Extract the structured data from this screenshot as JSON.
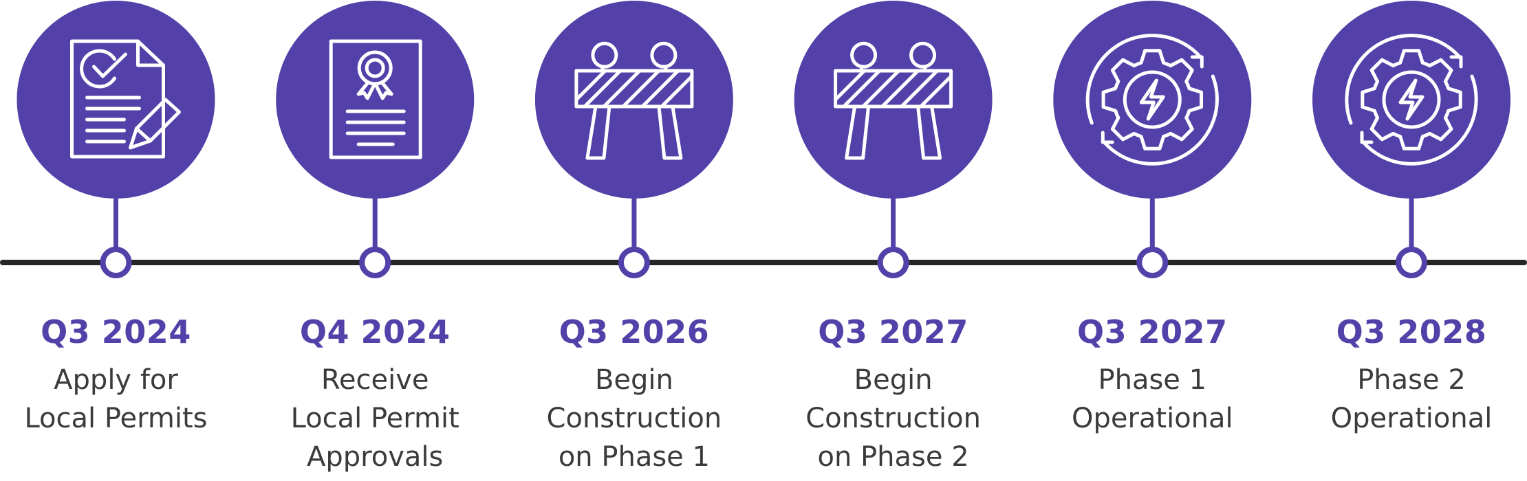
{
  "colors": {
    "accent": "#5340a8",
    "timeline": "#262626",
    "icon_stroke": "#ffffff",
    "description_text": "#3b3b3b",
    "background": "#ffffff"
  },
  "milestones": [
    {
      "date": "Q3 2024",
      "icon": "document-check-pencil-icon",
      "description_lines": [
        "Apply for",
        "Local Permits"
      ]
    },
    {
      "date": "Q4 2024",
      "icon": "certificate-ribbon-icon",
      "description_lines": [
        "Receive",
        "Local Permit",
        "Approvals"
      ]
    },
    {
      "date": "Q3 2026",
      "icon": "construction-barricade-icon",
      "description_lines": [
        "Begin",
        "Construction",
        "on Phase 1"
      ]
    },
    {
      "date": "Q3 2027",
      "icon": "construction-barricade-icon",
      "description_lines": [
        "Begin",
        "Construction",
        "on Phase 2"
      ]
    },
    {
      "date": "Q3 2027",
      "icon": "gear-lightning-cycle-icon",
      "description_lines": [
        "Phase 1",
        "Operational"
      ]
    },
    {
      "date": "Q3 2028",
      "icon": "gear-lightning-cycle-icon",
      "description_lines": [
        "Phase 2",
        "Operational"
      ]
    }
  ]
}
